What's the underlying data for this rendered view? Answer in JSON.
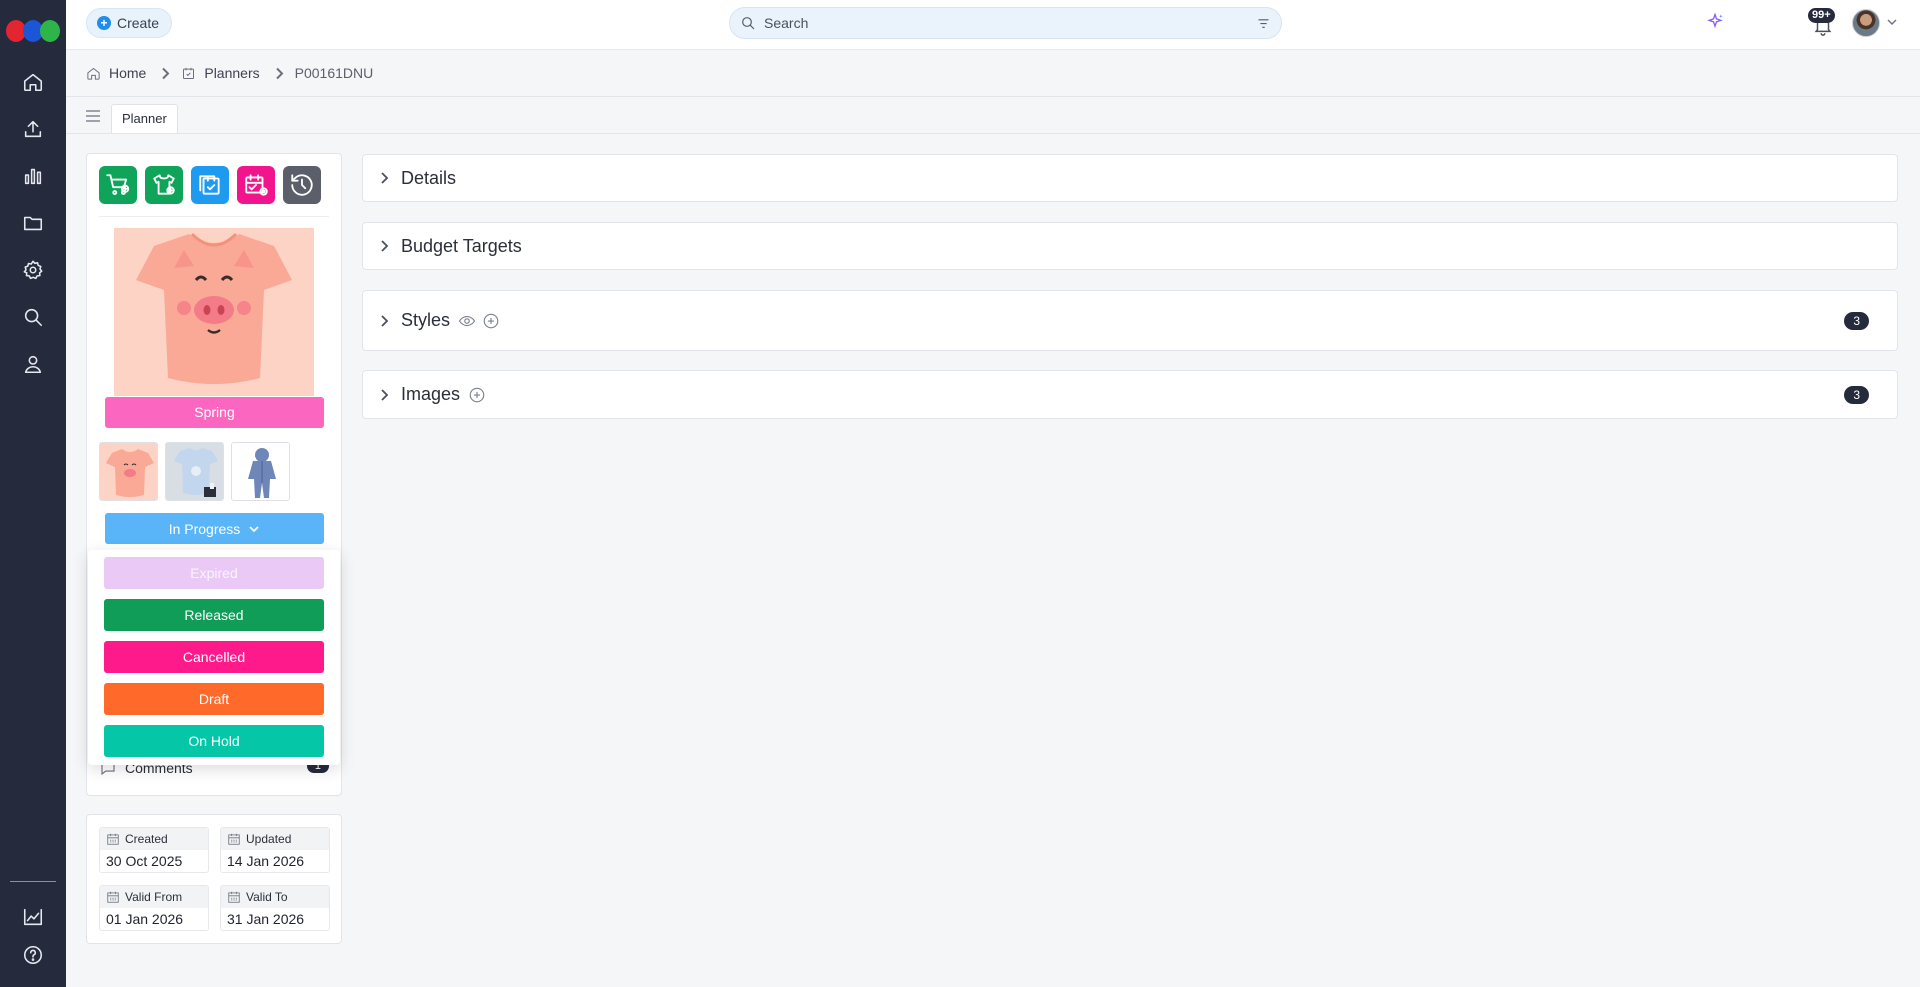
{
  "topbar": {
    "create_label": "Create",
    "search_placeholder": "Search",
    "notification_count": "99+"
  },
  "breadcrumb": {
    "items": [
      "Home",
      "Planners",
      "P00161DNU"
    ]
  },
  "tabs": [
    {
      "label": "Planner"
    }
  ],
  "panel": {
    "season": "Spring",
    "status": "In Progress",
    "comments_label": "Comments",
    "comments_count": "1",
    "status_options": [
      {
        "label": "Expired",
        "color": "#ebc9f7"
      },
      {
        "label": "Released",
        "color": "#0f9d58"
      },
      {
        "label": "Cancelled",
        "color": "#ff1a8c"
      },
      {
        "label": "Draft",
        "color": "#ff6a2b"
      },
      {
        "label": "On Hold",
        "color": "#05c7a8"
      }
    ],
    "toolbar_colors": [
      "#10a45a",
      "#10a45a",
      "#1e9bf0",
      "#f2148c",
      "#5b5f69"
    ],
    "season_color": "#fb67c0",
    "status_color": "#59b5f7"
  },
  "dates": {
    "created": {
      "label": "Created",
      "value": "30 Oct 2025"
    },
    "updated": {
      "label": "Updated",
      "value": "14 Jan 2026"
    },
    "valid_from": {
      "label": "Valid From",
      "value": "01 Jan 2026"
    },
    "valid_to": {
      "label": "Valid To",
      "value": "31 Jan 2026"
    }
  },
  "sections": {
    "details": {
      "title": "Details"
    },
    "budget": {
      "title": "Budget Targets"
    },
    "styles": {
      "title": "Styles",
      "count": "3"
    },
    "images": {
      "title": "Images",
      "count": "3"
    }
  }
}
